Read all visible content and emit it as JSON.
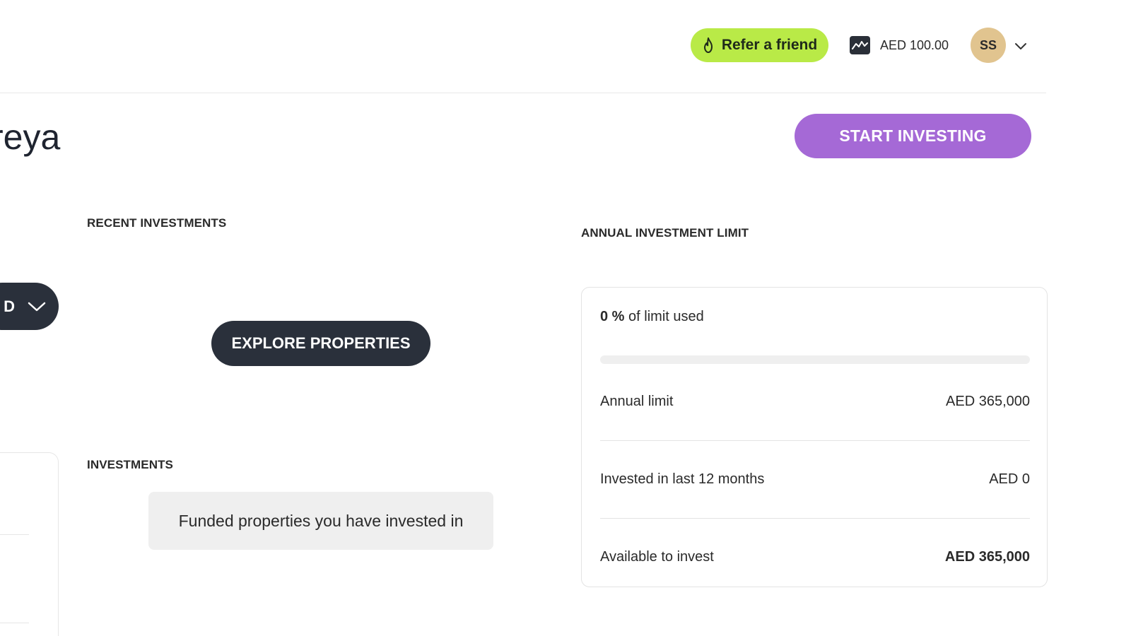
{
  "header": {
    "refer_label": "Refer a friend",
    "refer_icon": "flame-icon",
    "wallet_balance": "AED 100.00",
    "wallet_icon": "chart-trend-icon",
    "avatar_initials": "SS",
    "accent_color": "#b9ea47"
  },
  "page": {
    "title": "reya",
    "start_investing_label": "START INVESTING",
    "start_color": "#a569d6"
  },
  "left_panel": {
    "period_select_value": "D"
  },
  "recent": {
    "label": "RECENT INVESTMENTS",
    "explore_label": "EXPLORE PROPERTIES"
  },
  "investments": {
    "label": "INVESTMENTS",
    "tooltip": "Funded properties you have invested in"
  },
  "limit": {
    "label": "ANNUAL INVESTMENT LIMIT",
    "percent_used": "0 %",
    "usage_suffix": "of limit used",
    "progress_fraction": 0,
    "rows": [
      {
        "label": "Annual limit",
        "value": "AED 365,000"
      },
      {
        "label": "Invested in last 12 months",
        "value": "AED 0"
      },
      {
        "label": "Available to invest",
        "value": "AED 365,000"
      }
    ]
  }
}
